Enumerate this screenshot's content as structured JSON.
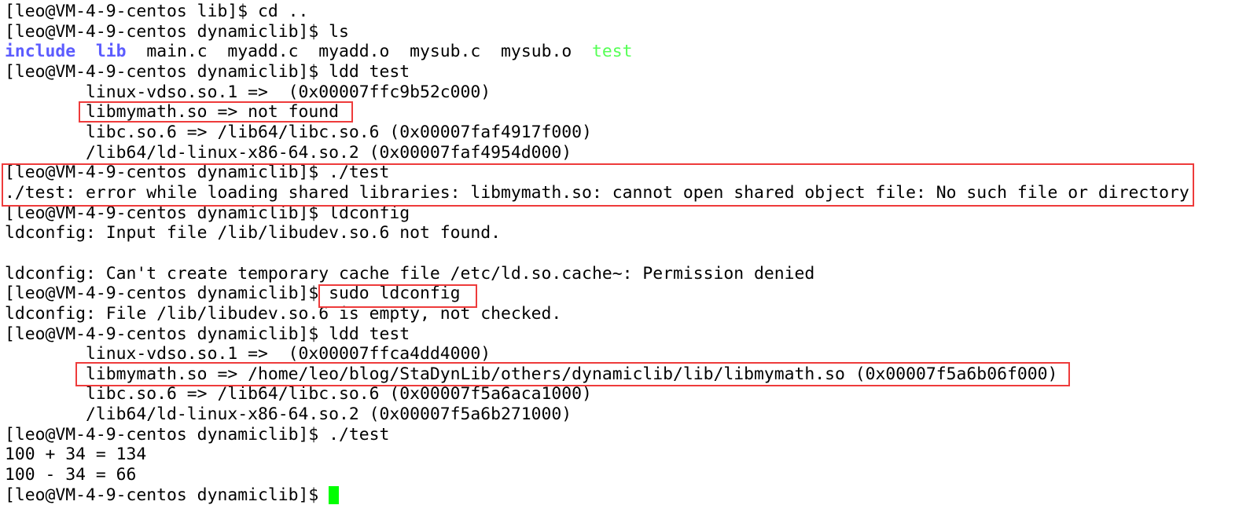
{
  "colors": {
    "directory": "#5c5cff",
    "executable": "#55ff55",
    "cursor": "#00ff00",
    "highlight_box": "#ee3b3b"
  },
  "terminal": {
    "lines": [
      [
        {
          "t": "[leo@VM-4-9-centos lib]$ cd .."
        }
      ],
      [
        {
          "t": "[leo@VM-4-9-centos dynamiclib]$ ls"
        }
      ],
      [
        {
          "t": "include",
          "c": "directory",
          "b": true
        },
        {
          "t": "  "
        },
        {
          "t": "lib",
          "c": "directory",
          "b": true
        },
        {
          "t": "  main.c  myadd.c  myadd.o  mysub.c  mysub.o  "
        },
        {
          "t": "test",
          "c": "executable"
        }
      ],
      [
        {
          "t": "[leo@VM-4-9-centos dynamiclib]$ ldd test"
        }
      ],
      [
        {
          "t": "        linux-vdso.so.1 =>  (0x00007ffc9b52c000)"
        }
      ],
      [
        {
          "t": "        libmymath.so => not found"
        }
      ],
      [
        {
          "t": "        libc.so.6 => /lib64/libc.so.6 (0x00007faf4917f000)"
        }
      ],
      [
        {
          "t": "        /lib64/ld-linux-x86-64.so.2 (0x00007faf4954d000)"
        }
      ],
      [
        {
          "t": "[leo@VM-4-9-centos dynamiclib]$ ./test"
        }
      ],
      [
        {
          "t": "./test: error while loading shared libraries: libmymath.so: cannot open shared object file: No such file or directory"
        }
      ],
      [
        {
          "t": "[leo@VM-4-9-centos dynamiclib]$ ldconfig"
        }
      ],
      [
        {
          "t": "ldconfig: Input file /lib/libudev.so.6 not found."
        }
      ],
      [
        {
          "t": ""
        }
      ],
      [
        {
          "t": "ldconfig: Can't create temporary cache file /etc/ld.so.cache~: Permission denied"
        }
      ],
      [
        {
          "t": "[leo@VM-4-9-centos dynamiclib]$ sudo ldconfig"
        }
      ],
      [
        {
          "t": "ldconfig: File /lib/libudev.so.6 is empty, not checked."
        }
      ],
      [
        {
          "t": "[leo@VM-4-9-centos dynamiclib]$ ldd test"
        }
      ],
      [
        {
          "t": "        linux-vdso.so.1 =>  (0x00007ffca4dd4000)"
        }
      ],
      [
        {
          "t": "        libmymath.so => /home/leo/blog/StaDynLib/others/dynamiclib/lib/libmymath.so (0x00007f5a6b06f000)"
        }
      ],
      [
        {
          "t": "        libc.so.6 => /lib64/libc.so.6 (0x00007f5a6aca1000)"
        }
      ],
      [
        {
          "t": "        /lib64/ld-linux-x86-64.so.2 (0x00007f5a6b271000)"
        }
      ],
      [
        {
          "t": "[leo@VM-4-9-centos dynamiclib]$ ./test"
        }
      ],
      [
        {
          "t": "100 + 34 = 134"
        }
      ],
      [
        {
          "t": "100 - 34 = 66"
        }
      ],
      [
        {
          "t": "[leo@VM-4-9-centos dynamiclib]$ "
        },
        {
          "cursor": true
        }
      ]
    ]
  }
}
